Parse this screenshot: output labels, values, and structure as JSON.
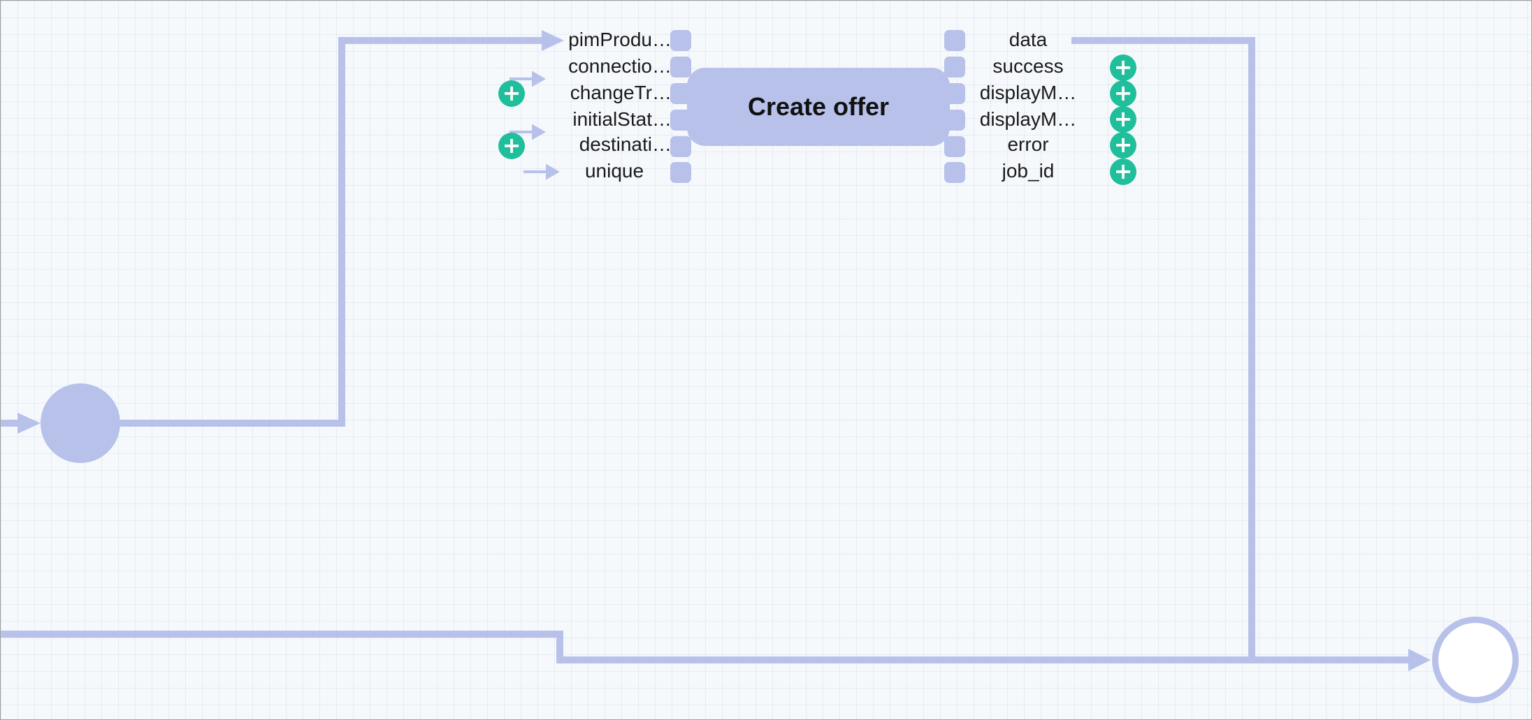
{
  "node": {
    "title": "Create offer",
    "inputs": [
      {
        "label": "pimProdu…"
      },
      {
        "label": "connectio…"
      },
      {
        "label": "changeTr…"
      },
      {
        "label": "initialStat…"
      },
      {
        "label": "destinati…"
      },
      {
        "label": "unique"
      }
    ],
    "outputs": [
      {
        "label": "data"
      },
      {
        "label": "success"
      },
      {
        "label": "displayM…"
      },
      {
        "label": "displayM…"
      },
      {
        "label": "error"
      },
      {
        "label": "job_id"
      }
    ]
  },
  "icons": {
    "add": "+"
  },
  "colors": {
    "wire": "#b7c1ea",
    "node": "#b7c1ea",
    "add_button": "#1fbf9b",
    "background": "#f6f9fc"
  }
}
